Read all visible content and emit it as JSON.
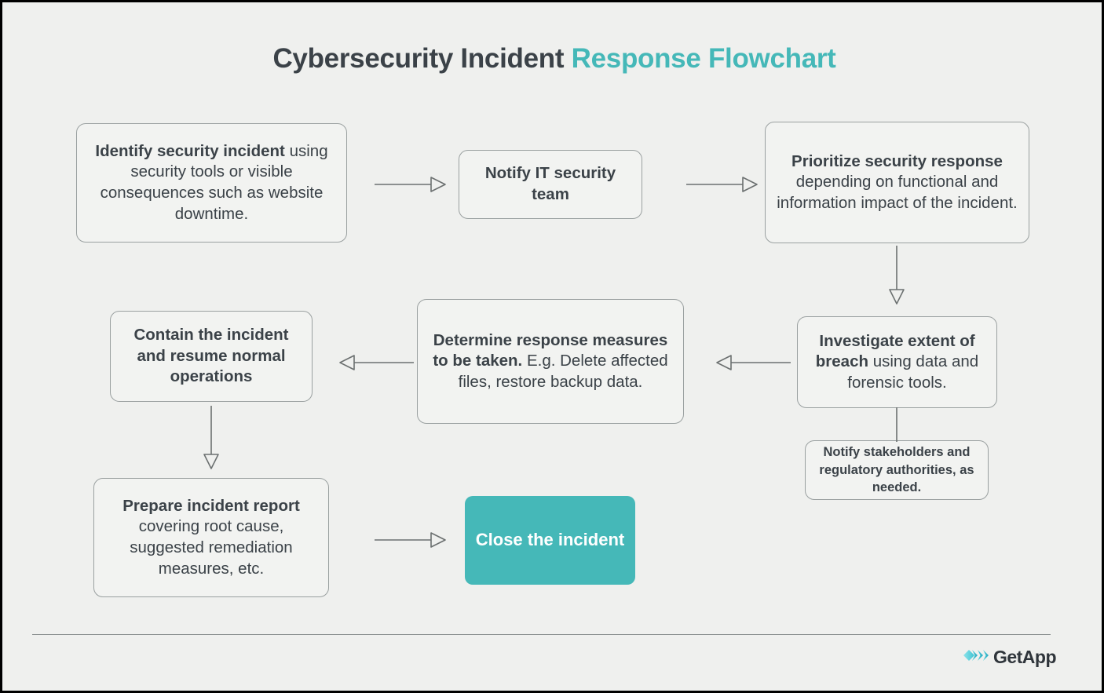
{
  "page": {
    "title_part_dark": "Cybersecurity Incident",
    "title_part_accent": "Response Flowchart",
    "background_color": "#EFF0EE",
    "accent_color": "#45B8B8",
    "text_color": "#3B4248",
    "border_color": "#9AA0A0"
  },
  "nodes": [
    {
      "id": "identify-security-incident",
      "heading": "Identify security incident",
      "body": "using security tools or visible consequences such as website downtime.",
      "style": "outlined"
    },
    {
      "id": "notify-it-security-team",
      "heading": "Notify IT security team",
      "body": "",
      "style": "outlined"
    },
    {
      "id": "prioritize-security-response",
      "heading": "Prioritize security response",
      "body": "depending on functional and information impact of the incident.",
      "style": "outlined"
    },
    {
      "id": "investigate-extent-of-breach",
      "heading": "Investigate extent of breach",
      "body": " using data and forensic tools.",
      "style": "outlined-inline"
    },
    {
      "id": "notify-stakeholders",
      "heading": "Notify stakeholders and regulatory authorities, as needed.",
      "body": "",
      "style": "outlined-small"
    },
    {
      "id": "determine-response-measures",
      "heading": "Determine response measures to be taken.",
      "body": "E.g. Delete affected files, restore backup data.",
      "style": "outlined"
    },
    {
      "id": "contain-the-incident",
      "heading": "Contain the incident and resume normal operations",
      "body": "",
      "style": "outlined"
    },
    {
      "id": "prepare-incident-report",
      "heading": "Prepare incident report",
      "body": "covering root cause, suggested remediation measures, etc.",
      "style": "outlined"
    },
    {
      "id": "close-the-incident",
      "heading": "Close the incident",
      "body": "",
      "style": "terminal"
    }
  ],
  "connectors": [
    {
      "id": "identify-to-notify",
      "direction": "right",
      "arrowhead": true
    },
    {
      "id": "notify-to-prioritize",
      "direction": "right",
      "arrowhead": true
    },
    {
      "id": "prioritize-to-investigate",
      "direction": "down",
      "arrowhead": true
    },
    {
      "id": "investigate-to-stakeholders",
      "direction": "down",
      "arrowhead": false
    },
    {
      "id": "investigate-to-determine",
      "direction": "left",
      "arrowhead": true
    },
    {
      "id": "determine-to-contain",
      "direction": "left",
      "arrowhead": true
    },
    {
      "id": "contain-to-report",
      "direction": "down",
      "arrowhead": true
    },
    {
      "id": "report-to-close",
      "direction": "right",
      "arrowhead": true
    }
  ],
  "footer": {
    "brand_name": "GetApp",
    "brand_mark": "chevron-logo-icon"
  }
}
